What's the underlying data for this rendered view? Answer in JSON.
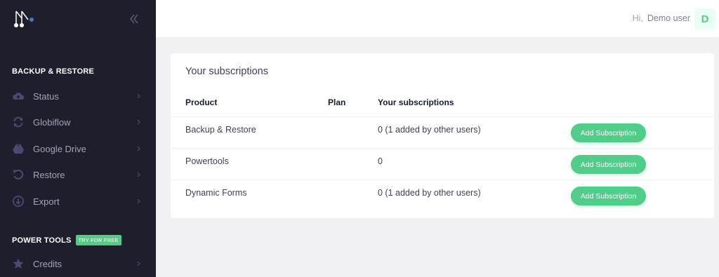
{
  "sidebar": {
    "sections": [
      {
        "title": "BACKUP & RESTORE"
      },
      {
        "title": "POWER TOOLS",
        "badge": "TRY FOR FREE"
      }
    ],
    "items": [
      {
        "label": "Status",
        "icon": "cloud-upload-icon"
      },
      {
        "label": "Globiflow",
        "icon": "sync-icon"
      },
      {
        "label": "Google Drive",
        "icon": "google-drive-icon"
      },
      {
        "label": "Restore",
        "icon": "restore-icon"
      },
      {
        "label": "Export",
        "icon": "download-icon"
      },
      {
        "label": "Credits",
        "icon": "star-icon"
      }
    ]
  },
  "header": {
    "greeting": "Hi,",
    "user_name": "Demo user",
    "avatar_letter": "D"
  },
  "main": {
    "title": "Your subscriptions",
    "columns": [
      "Product",
      "Plan",
      "Your subscriptions"
    ],
    "rows": [
      {
        "product": "Backup & Restore",
        "plan": "",
        "subscriptions": "0 (1 added by other users)",
        "action": "Add Subscription"
      },
      {
        "product": "Powertools",
        "plan": "",
        "subscriptions": "0",
        "action": "Add Subscription"
      },
      {
        "product": "Dynamic Forms",
        "plan": "",
        "subscriptions": "0 (1 added by other users)",
        "action": "Add Subscription"
      }
    ]
  },
  "colors": {
    "sidebar_bg": "#1e1e2d",
    "accent_green": "#50cd89",
    "page_bg": "#f1f1f4"
  }
}
